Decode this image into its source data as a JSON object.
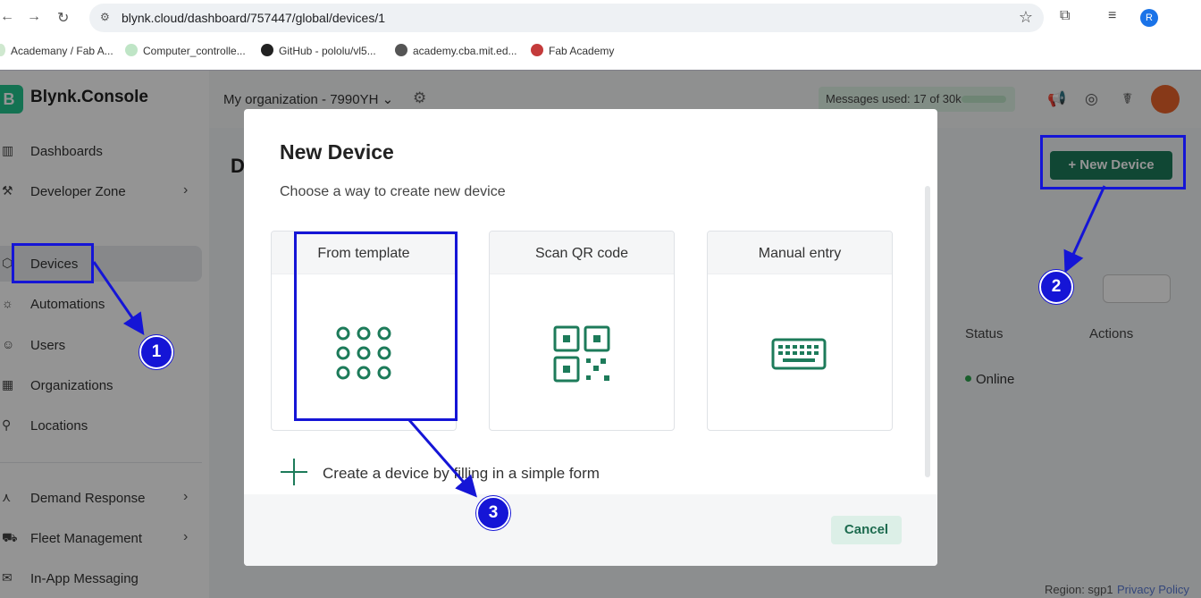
{
  "browser": {
    "url": "blynk.cloud/dashboard/757447/global/devices/1",
    "profile_initial": "R",
    "bookmarks": [
      "Academany / Fab A...",
      "Computer_controlle...",
      "GitHub - pololu/vl5...",
      "academy.cba.mit.ed...",
      "Fab Academy"
    ]
  },
  "app": {
    "logo_letter": "B",
    "logo_text": "Blynk.Console",
    "organization": "My organization - 7990YH",
    "messages_used": "Messages used: 17 of 30k",
    "page_title": "D",
    "new_device_label": "+ New Device",
    "table_headers": {
      "status": "Status",
      "actions": "Actions"
    },
    "row_status": "Online",
    "region": "Region: sgp1",
    "privacy_link": "Privacy Policy"
  },
  "sidebar": {
    "items": [
      {
        "label": "Dashboards",
        "icon": "bar-chart-icon",
        "glyph": "▥"
      },
      {
        "label": "Developer Zone",
        "icon": "tools-icon",
        "glyph": "⚒"
      },
      {
        "label": "Devices",
        "icon": "cube-icon",
        "glyph": "⬡"
      },
      {
        "label": "Automations",
        "icon": "sun-icon",
        "glyph": "☼"
      },
      {
        "label": "Users",
        "icon": "users-icon",
        "glyph": "☺"
      },
      {
        "label": "Organizations",
        "icon": "building-icon",
        "glyph": "▦"
      },
      {
        "label": "Locations",
        "icon": "pin-icon",
        "glyph": "⚲"
      },
      {
        "label": "Demand Response",
        "icon": "signal-icon",
        "glyph": "⋏"
      },
      {
        "label": "Fleet Management",
        "icon": "truck-icon",
        "glyph": "⛟"
      },
      {
        "label": "In-App Messaging",
        "icon": "message-icon",
        "glyph": "✉"
      }
    ]
  },
  "modal": {
    "title": "New Device",
    "subtitle": "Choose a way to create new device",
    "options": [
      {
        "label": "From template",
        "icon": "template-grid-icon"
      },
      {
        "label": "Scan QR code",
        "icon": "qr-code-icon"
      },
      {
        "label": "Manual entry",
        "icon": "keyboard-icon"
      }
    ],
    "create_text": "Create a device by filling in a simple form",
    "cancel_label": "Cancel"
  },
  "annotations": [
    "1",
    "2",
    "3"
  ],
  "colors": {
    "brand_green": "#1d7b5a",
    "annotation_blue": "#1515d6",
    "icon_green": "#1d7b5a"
  }
}
